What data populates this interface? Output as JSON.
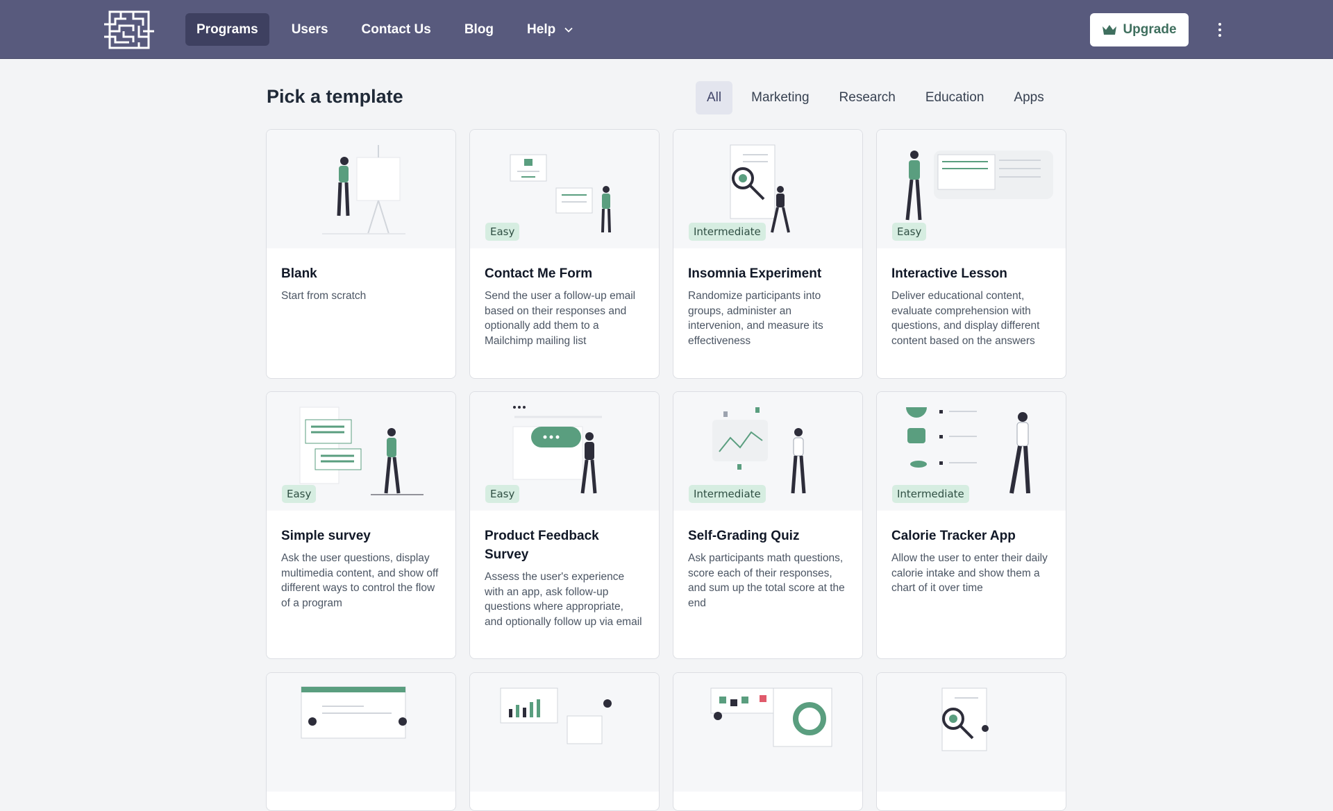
{
  "nav": {
    "items": [
      {
        "label": "Programs",
        "active": true
      },
      {
        "label": "Users"
      },
      {
        "label": "Contact Us"
      },
      {
        "label": "Blog"
      },
      {
        "label": "Help",
        "dropdown": true
      }
    ],
    "upgrade_label": "Upgrade",
    "more_icon": "vertical-dots-icon",
    "logo_icon": "maze-logo-icon"
  },
  "page": {
    "title": "Pick a template",
    "filters": [
      "All",
      "Marketing",
      "Research",
      "Education",
      "Apps"
    ],
    "active_filter": "All"
  },
  "colors": {
    "nav_bg": "#585a7d",
    "nav_active": "#3e4060",
    "accent_green": "#5a9e7f",
    "badge_bg": "#d6ede1"
  },
  "cards": [
    {
      "title": "Blank",
      "description": "Start from scratch",
      "badge": ""
    },
    {
      "title": "Contact Me Form",
      "description": "Send the user a follow-up email based on their responses and optionally add them to a Mailchimp mailing list",
      "badge": "Easy"
    },
    {
      "title": "Insomnia Experiment",
      "description": "Randomize participants into groups, administer an intervenion, and measure its effectiveness",
      "badge": "Intermediate"
    },
    {
      "title": "Interactive Lesson",
      "description": "Deliver educational content, evaluate comprehension with questions, and display different content based on the answers",
      "badge": "Easy"
    },
    {
      "title": "Simple survey",
      "description": "Ask the user questions, display multimedia content, and show off different ways to control the flow of a program",
      "badge": "Easy"
    },
    {
      "title": "Product Feedback Survey",
      "description": "Assess the user's experience with an app, ask follow-up questions where appropriate, and optionally follow up via email",
      "badge": "Easy"
    },
    {
      "title": "Self-Grading Quiz",
      "description": "Ask participants math questions, score each of their responses, and sum up the total score at the end",
      "badge": "Intermediate"
    },
    {
      "title": "Calorie Tracker App",
      "description": "Allow the user to enter their daily calorie intake and show them a chart of it over time",
      "badge": "Intermediate"
    },
    {
      "title": "",
      "description": "",
      "badge": ""
    },
    {
      "title": "",
      "description": "",
      "badge": ""
    },
    {
      "title": "",
      "description": "",
      "badge": ""
    },
    {
      "title": "",
      "description": "",
      "badge": ""
    }
  ]
}
